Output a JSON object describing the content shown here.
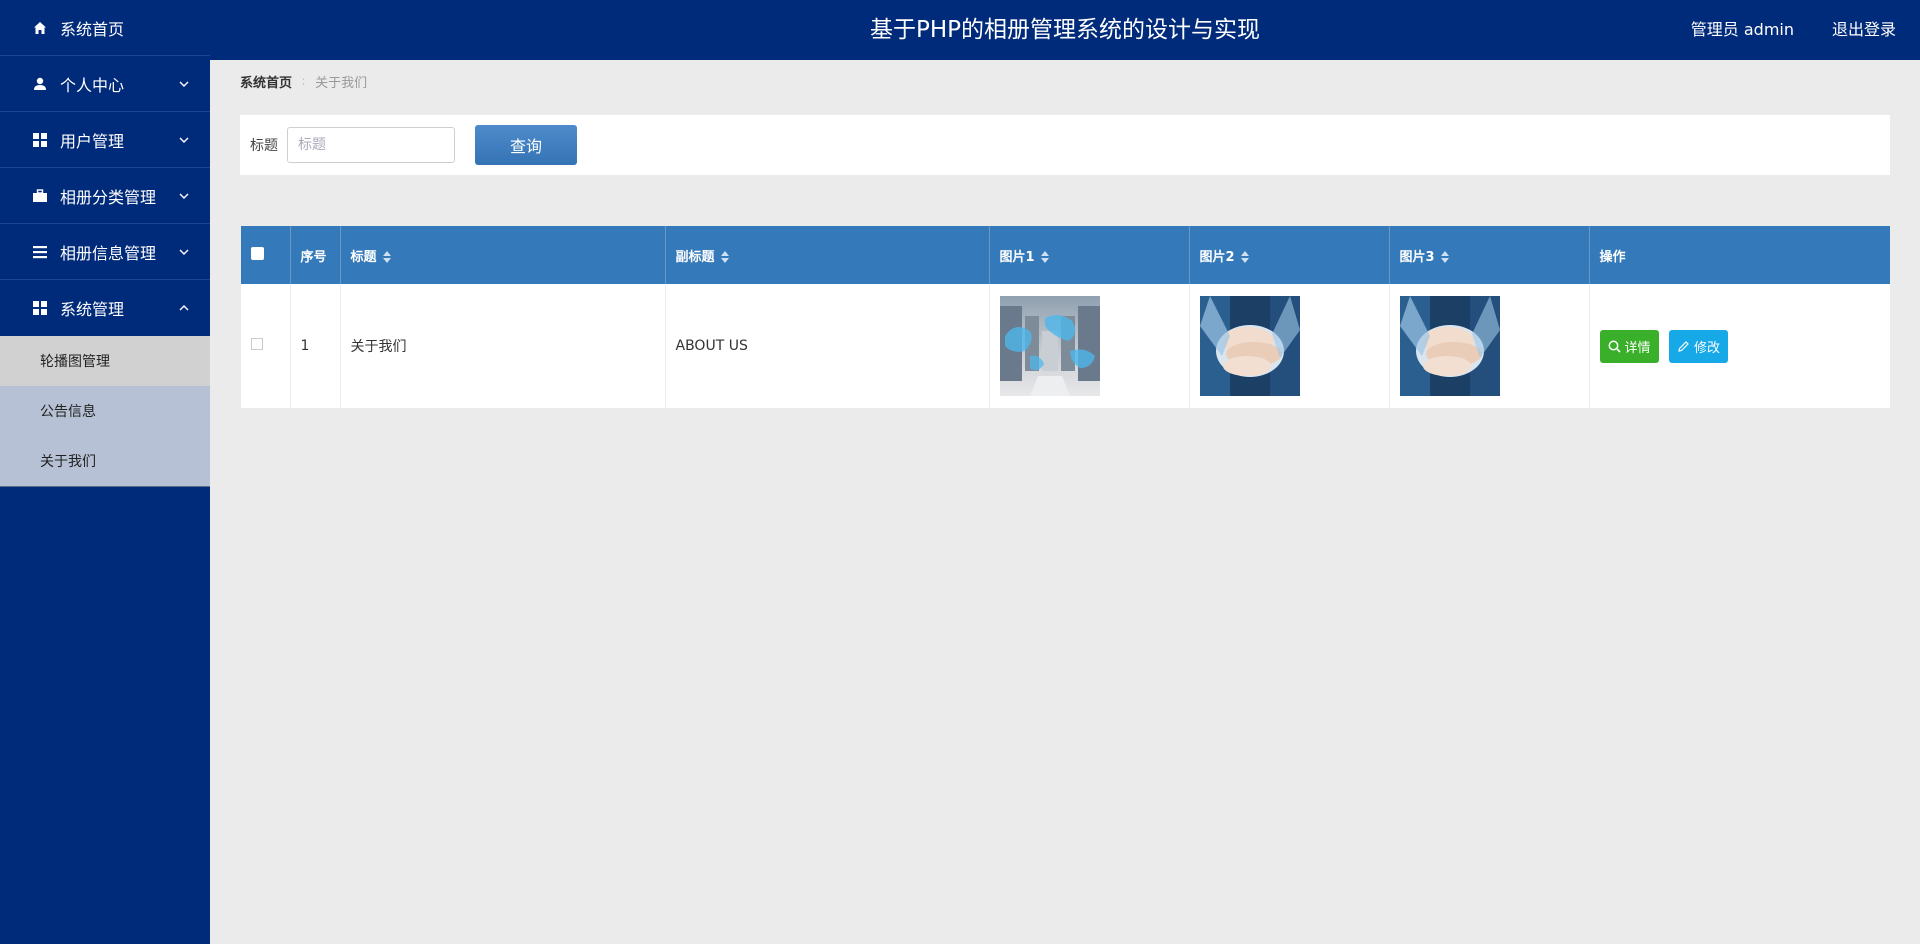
{
  "header": {
    "title": "基于PHP的相册管理系统的设计与实现",
    "user": "管理员 admin",
    "logout": "退出登录"
  },
  "sidebar": {
    "items": [
      {
        "label": "系统首页",
        "icon": "home-icon"
      },
      {
        "label": "个人中心",
        "icon": "user-icon",
        "expandable": true,
        "expanded": false
      },
      {
        "label": "用户管理",
        "icon": "grid-icon",
        "expandable": true,
        "expanded": false
      },
      {
        "label": "相册分类管理",
        "icon": "briefcase-icon",
        "expandable": true,
        "expanded": false
      },
      {
        "label": "相册信息管理",
        "icon": "list-icon",
        "expandable": true,
        "expanded": false
      },
      {
        "label": "系统管理",
        "icon": "grid-icon",
        "expandable": true,
        "expanded": true
      }
    ],
    "submenu": [
      {
        "label": "轮播图管理",
        "active": true
      },
      {
        "label": "公告信息",
        "active": false
      },
      {
        "label": "关于我们",
        "active": false
      }
    ]
  },
  "breadcrumb": {
    "home": "系统首页",
    "separator": "∶",
    "current": "关于我们"
  },
  "search": {
    "label": "标题",
    "placeholder": "标题",
    "button": "查询"
  },
  "table": {
    "columns": [
      "序号",
      "标题",
      "副标题",
      "图片1",
      "图片2",
      "图片3",
      "操作"
    ],
    "rows": [
      {
        "index": "1",
        "title": "关于我们",
        "subtitle": "ABOUT US",
        "images": [
          "warehouse-world-map",
          "stacked-hands",
          "stacked-hands"
        ]
      }
    ],
    "actions": {
      "detail": "详情",
      "edit": "修改"
    }
  },
  "colors": {
    "sidebar": "#002a7a",
    "header": "#002a7a",
    "table_header": "#3479b9",
    "detail_button": "#3ab02a",
    "edit_button": "#17a8e8"
  }
}
